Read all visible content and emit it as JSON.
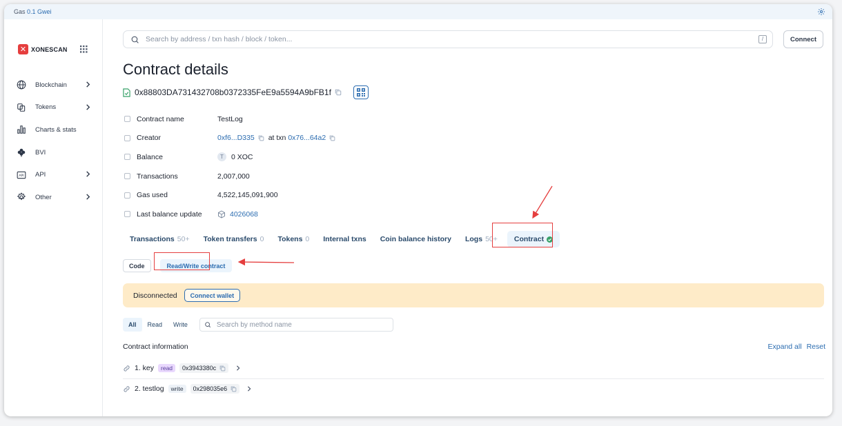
{
  "topbar": {
    "gas_label": "Gas",
    "gas_value": "0.1 Gwei"
  },
  "sidebar": {
    "logo_text": "XONESCAN",
    "items": [
      {
        "label": "Blockchain",
        "icon": "globe-icon",
        "has_chevron": true
      },
      {
        "label": "Tokens",
        "icon": "tokens-icon",
        "has_chevron": true
      },
      {
        "label": "Charts & stats",
        "icon": "chart-icon",
        "has_chevron": false
      },
      {
        "label": "BVI",
        "icon": "flower-icon",
        "has_chevron": false
      },
      {
        "label": "API",
        "icon": "api-icon",
        "has_chevron": true
      },
      {
        "label": "Other",
        "icon": "gear-icon",
        "has_chevron": true
      }
    ]
  },
  "header": {
    "search_placeholder": "Search by address / txn hash / block / token...",
    "search_shortcut": "/",
    "connect_label": "Connect"
  },
  "page": {
    "title": "Contract details",
    "address": "0x88803DA731432708b0372335FeE9a5594A9bFB1f"
  },
  "details": {
    "contract_name_label": "Contract name",
    "contract_name": "TestLog",
    "creator_label": "Creator",
    "creator_addr": "0xf6...D335",
    "at_txn": "at txn",
    "creator_txn": "0x76...64a2",
    "balance_label": "Balance",
    "balance_coin": "T",
    "balance_value": "0 XOC",
    "transactions_label": "Transactions",
    "transactions_value": "2,007,000",
    "gas_used_label": "Gas used",
    "gas_used_value": "4,522,145,091,900",
    "last_balance_label": "Last balance update",
    "last_balance_block": "4026068"
  },
  "tabs": [
    {
      "label": "Transactions",
      "count": "50+"
    },
    {
      "label": "Token transfers",
      "count": "0"
    },
    {
      "label": "Tokens",
      "count": "0"
    },
    {
      "label": "Internal txns",
      "count": ""
    },
    {
      "label": "Coin balance history",
      "count": ""
    },
    {
      "label": "Logs",
      "count": "50+"
    },
    {
      "label": "Contract",
      "count": ""
    }
  ],
  "subtabs": {
    "code": "Code",
    "read_write": "Read/Write contract"
  },
  "banner": {
    "status": "Disconnected",
    "connect_wallet": "Connect wallet"
  },
  "filter": {
    "all": "All",
    "read": "Read",
    "write": "Write",
    "search_placeholder": "Search by method name"
  },
  "contract_info": {
    "title": "Contract information",
    "expand_all": "Expand all",
    "reset": "Reset"
  },
  "methods": [
    {
      "name": "1. key",
      "type": "read",
      "hash": "0x3943380c"
    },
    {
      "name": "2. testlog",
      "type": "write",
      "hash": "0x298035e6"
    }
  ],
  "colors": {
    "accent": "#2b6cb0",
    "annotation_red": "#e53e3e",
    "banner_bg": "#feebc8",
    "success_green": "#38a169"
  }
}
